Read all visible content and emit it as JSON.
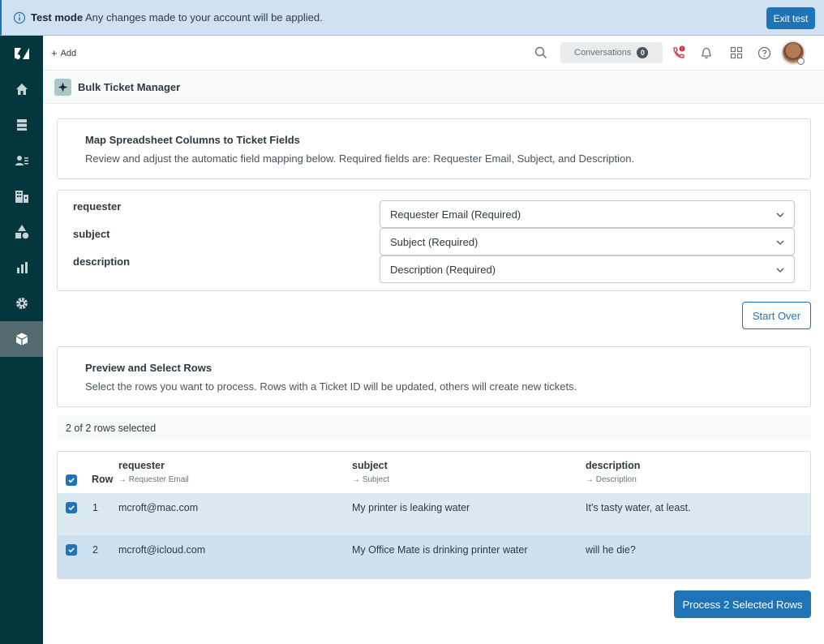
{
  "banner": {
    "title": "Test mode",
    "message": "Any changes made to your account will be applied.",
    "exit_label": "Exit test"
  },
  "sidebar": {
    "items": [
      {
        "icon": "zendesk-logo-icon"
      },
      {
        "icon": "home-icon"
      },
      {
        "icon": "views-icon"
      },
      {
        "icon": "customers-icon"
      },
      {
        "icon": "organizations-icon"
      },
      {
        "icon": "objects-icon"
      },
      {
        "icon": "reporting-icon"
      },
      {
        "icon": "admin-gear-icon"
      },
      {
        "icon": "apps-cube-icon",
        "active": true
      }
    ]
  },
  "topbar": {
    "add_label": "Add",
    "conversations_label": "Conversations",
    "conversations_count": "0",
    "talk_badge": "!"
  },
  "app": {
    "title": "Bulk Ticket Manager"
  },
  "mapping": {
    "title": "Map Spreadsheet Columns to Ticket Fields",
    "description": "Review and adjust the automatic field mapping below. Required fields are: Requester Email, Subject, and Description.",
    "fields": [
      {
        "column": "requester",
        "value": "Requester Email (Required)"
      },
      {
        "column": "subject",
        "value": "Subject (Required)"
      },
      {
        "column": "description",
        "value": "Description (Required)"
      }
    ]
  },
  "start_over_label": "Start Over",
  "preview": {
    "title": "Preview and Select Rows",
    "description": "Select the rows you want to process. Rows with a Ticket ID will be updated, others will create new tickets.",
    "selected_text": "2 of 2 rows selected"
  },
  "table": {
    "row_header": "Row",
    "columns": [
      {
        "name": "requester",
        "mapped": "→ Requester Email"
      },
      {
        "name": "subject",
        "mapped": "→ Subject"
      },
      {
        "name": "description",
        "mapped": "→ Description"
      }
    ],
    "rows": [
      {
        "row": "1",
        "requester": "mcroft@mac.com",
        "subject": "My printer is leaking water",
        "description": "It's tasty water, at least.",
        "checked": true
      },
      {
        "row": "2",
        "requester": "mcroft@icloud.com",
        "subject": "My Office Mate is drinking printer water",
        "description": "will he die?",
        "checked": true
      }
    ]
  },
  "process_label": "Process 2 Selected Rows",
  "colors": {
    "brand_blue": "#1f73b7",
    "sidebar": "#03363d",
    "banner": "#cfe1f3"
  }
}
